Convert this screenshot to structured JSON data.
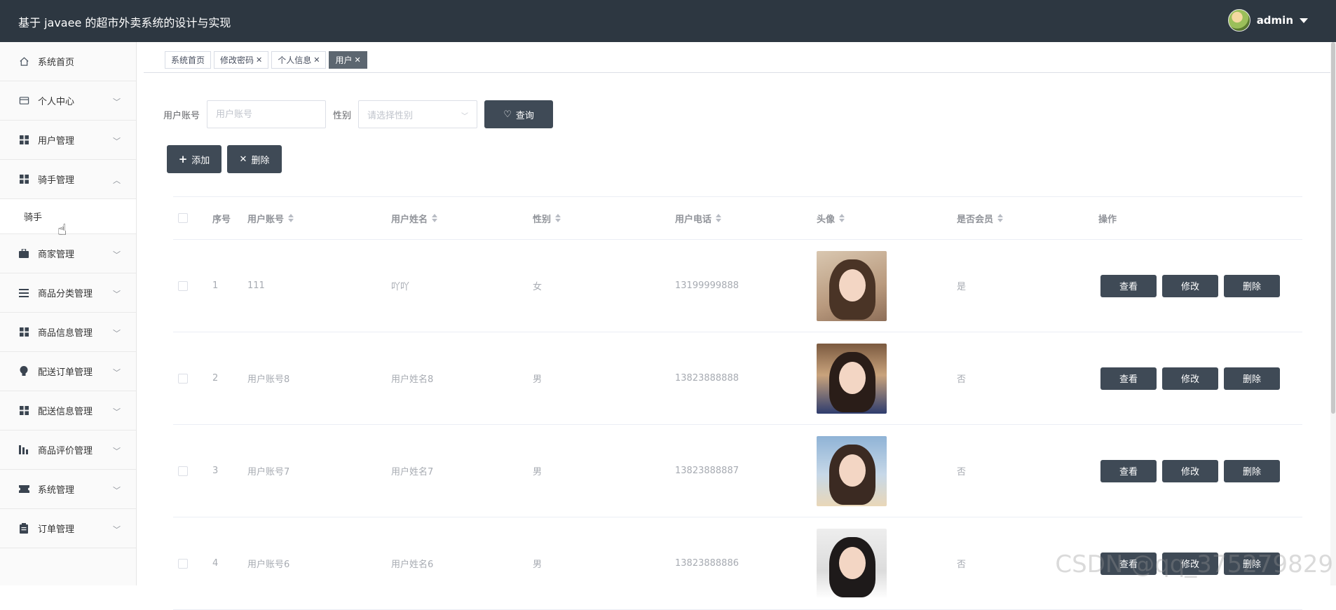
{
  "app": {
    "title": "基于 javaee 的超市外卖系统的设计与实现"
  },
  "user": {
    "name": "admin"
  },
  "sidebar": {
    "items": [
      {
        "label": "系统首页",
        "icon": "home-icon"
      },
      {
        "label": "个人中心",
        "icon": "card-icon"
      },
      {
        "label": "用户管理",
        "icon": "grid-icon"
      },
      {
        "label": "骑手管理",
        "icon": "grid-icon",
        "children": [
          {
            "label": "骑手"
          }
        ]
      },
      {
        "label": "商家管理",
        "icon": "briefcase-icon"
      },
      {
        "label": "商品分类管理",
        "icon": "list-icon"
      },
      {
        "label": "商品信息管理",
        "icon": "grid-icon"
      },
      {
        "label": "配送订单管理",
        "icon": "bulb-icon"
      },
      {
        "label": "配送信息管理",
        "icon": "grid-icon"
      },
      {
        "label": "商品评价管理",
        "icon": "chart-icon"
      },
      {
        "label": "系统管理",
        "icon": "ticket-icon"
      },
      {
        "label": "订单管理",
        "icon": "clipboard-icon"
      }
    ]
  },
  "tabs": [
    {
      "label": "系统首页",
      "closable": false
    },
    {
      "label": "修改密码",
      "closable": true
    },
    {
      "label": "个人信息",
      "closable": true
    },
    {
      "label": "用户",
      "closable": true,
      "active": true
    }
  ],
  "search": {
    "account_label": "用户账号",
    "account_placeholder": "用户账号",
    "gender_label": "性别",
    "gender_placeholder": "请选择性别",
    "query_label": "查询"
  },
  "toolbar": {
    "add_label": "添加",
    "delete_label": "删除"
  },
  "table": {
    "headers": {
      "index": "序号",
      "account": "用户账号",
      "name": "用户姓名",
      "gender": "性别",
      "phone": "用户电话",
      "avatar": "头像",
      "member": "是否会员",
      "ops": "操作"
    },
    "rows": [
      {
        "index": "1",
        "account": "111",
        "name": "吖吖",
        "gender": "女",
        "phone": "13199999888",
        "member": "是"
      },
      {
        "index": "2",
        "account": "用户账号8",
        "name": "用户姓名8",
        "gender": "男",
        "phone": "13823888888",
        "member": "否"
      },
      {
        "index": "3",
        "account": "用户账号7",
        "name": "用户姓名7",
        "gender": "男",
        "phone": "13823888887",
        "member": "否"
      },
      {
        "index": "4",
        "account": "用户账号6",
        "name": "用户姓名6",
        "gender": "男",
        "phone": "13823888886",
        "member": "否"
      }
    ],
    "op_labels": {
      "view": "查看",
      "edit": "修改",
      "delete": "删除"
    }
  },
  "watermark": "CSDN @qq_375279829",
  "colors": {
    "header_bg": "#2d3741",
    "button_dark": "#3f4a56",
    "active_tab": "#5c6670"
  }
}
